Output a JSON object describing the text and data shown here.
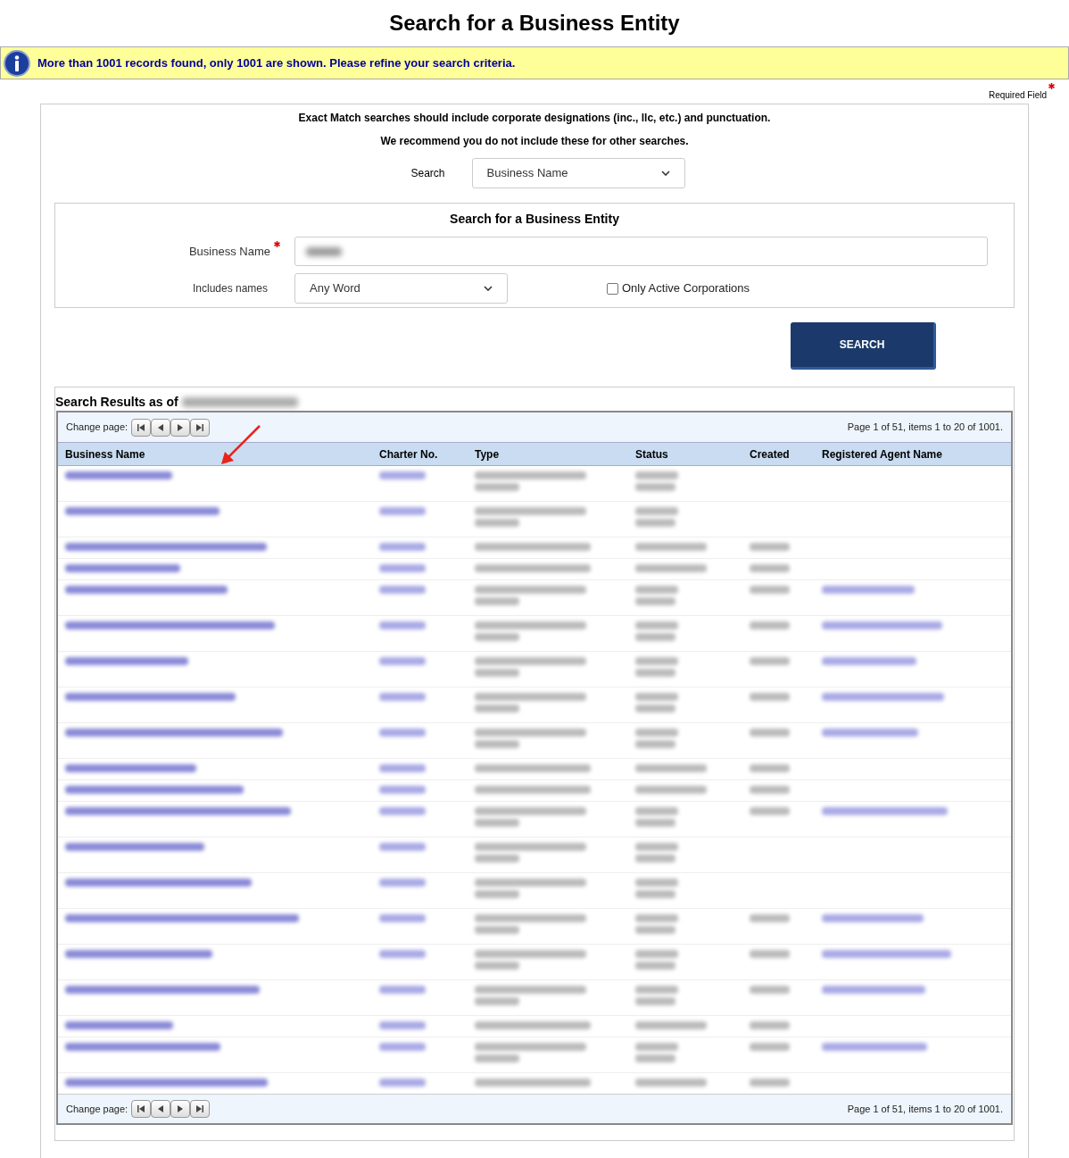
{
  "title": "Search for a Business Entity",
  "notice": "More than 1001 records found, only 1001 are shown. Please refine your search criteria.",
  "required_legend": "Required Field",
  "instructions": [
    "Exact Match searches should include corporate designations (inc., llc, etc.) and punctuation.",
    "We recommend you do not include these for other searches."
  ],
  "search_type": {
    "label": "Search",
    "value": "Business Name"
  },
  "form": {
    "title": "Search for a Business Entity",
    "name_label": "Business Name",
    "includes_label": "Includes names",
    "includes_value": "Any Word",
    "active_label": "Only Active Corporations",
    "active_checked": false
  },
  "search_button": "SEARCH",
  "results": {
    "heading": "Search Results as of",
    "pagers": [
      {
        "label": "Change page:",
        "page_info": "Page 1 of 51, items 1 to 20 of 1001."
      },
      {
        "label": "Change page:",
        "page_info": "Page 1 of 51, items 1 to 20 of 1001."
      }
    ],
    "columns": [
      "Business Name",
      "Charter No.",
      "Type",
      "Status",
      "Created",
      "Registered Agent Name"
    ],
    "rows": [
      {
        "kind": "double",
        "created": false,
        "agent": false
      },
      {
        "kind": "double",
        "created": false,
        "agent": false
      },
      {
        "kind": "single",
        "created": true,
        "agent": false
      },
      {
        "kind": "single",
        "created": true,
        "agent": false
      },
      {
        "kind": "double",
        "created": true,
        "agent": true
      },
      {
        "kind": "double",
        "created": true,
        "agent": true
      },
      {
        "kind": "double",
        "created": true,
        "agent": true
      },
      {
        "kind": "double",
        "created": true,
        "agent": true
      },
      {
        "kind": "double",
        "created": true,
        "agent": true
      },
      {
        "kind": "single",
        "created": true,
        "agent": false
      },
      {
        "kind": "single",
        "created": true,
        "agent": false
      },
      {
        "kind": "double",
        "created": true,
        "agent": true
      },
      {
        "kind": "double",
        "created": false,
        "agent": false
      },
      {
        "kind": "double",
        "created": false,
        "agent": false
      },
      {
        "kind": "double",
        "created": true,
        "agent": true
      },
      {
        "kind": "double",
        "created": true,
        "agent": true
      },
      {
        "kind": "double",
        "created": true,
        "agent": true
      },
      {
        "kind": "single",
        "created": true,
        "agent": false
      },
      {
        "kind": "double",
        "created": true,
        "agent": true
      },
      {
        "kind": "single",
        "created": true,
        "agent": false
      }
    ]
  }
}
